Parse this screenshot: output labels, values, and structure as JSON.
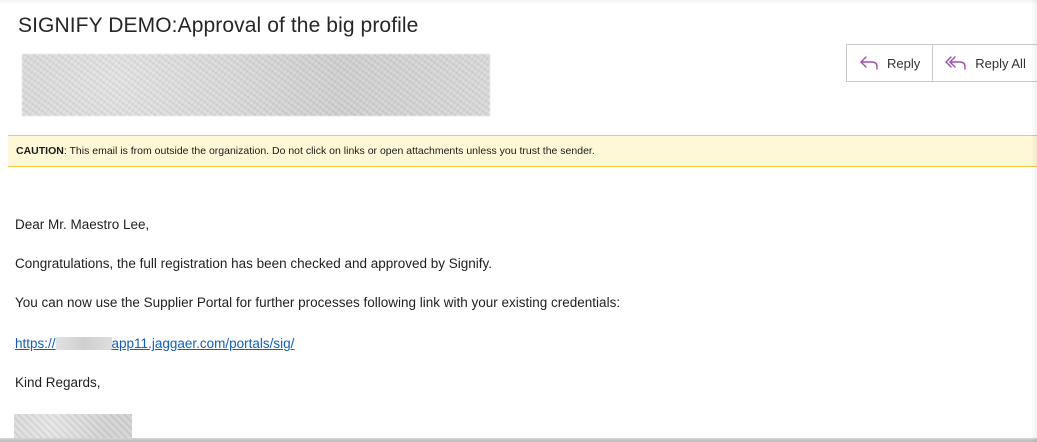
{
  "email": {
    "subject": "SIGNIFY DEMO:Approval of the big profile",
    "actions": {
      "reply_label": "Reply",
      "reply_all_label": "Reply All"
    },
    "caution": {
      "prefix": "CAUTION",
      "message": ": This email is from outside the organization. Do not click on links or open attachments unless you trust the sender."
    },
    "body": {
      "greeting": "Dear Mr. Maestro Lee,",
      "line1": "Congratulations, the full registration has been checked and approved by Signify.",
      "line2": "You can now use the Supplier Portal for further processes following link with your existing credentials:",
      "link_prefix": "https://",
      "link_suffix": "app11.jaggaer.com/portals/sig/",
      "closing": "Kind Regards,"
    }
  },
  "icons": {
    "reply": "reply-arrow-icon",
    "reply_all": "reply-all-arrow-icon"
  },
  "colors": {
    "accent_icon": "#a24bb3",
    "link": "#0f5fbf",
    "caution_bg": "#fff8d6",
    "caution_border": "#f2c94c"
  }
}
